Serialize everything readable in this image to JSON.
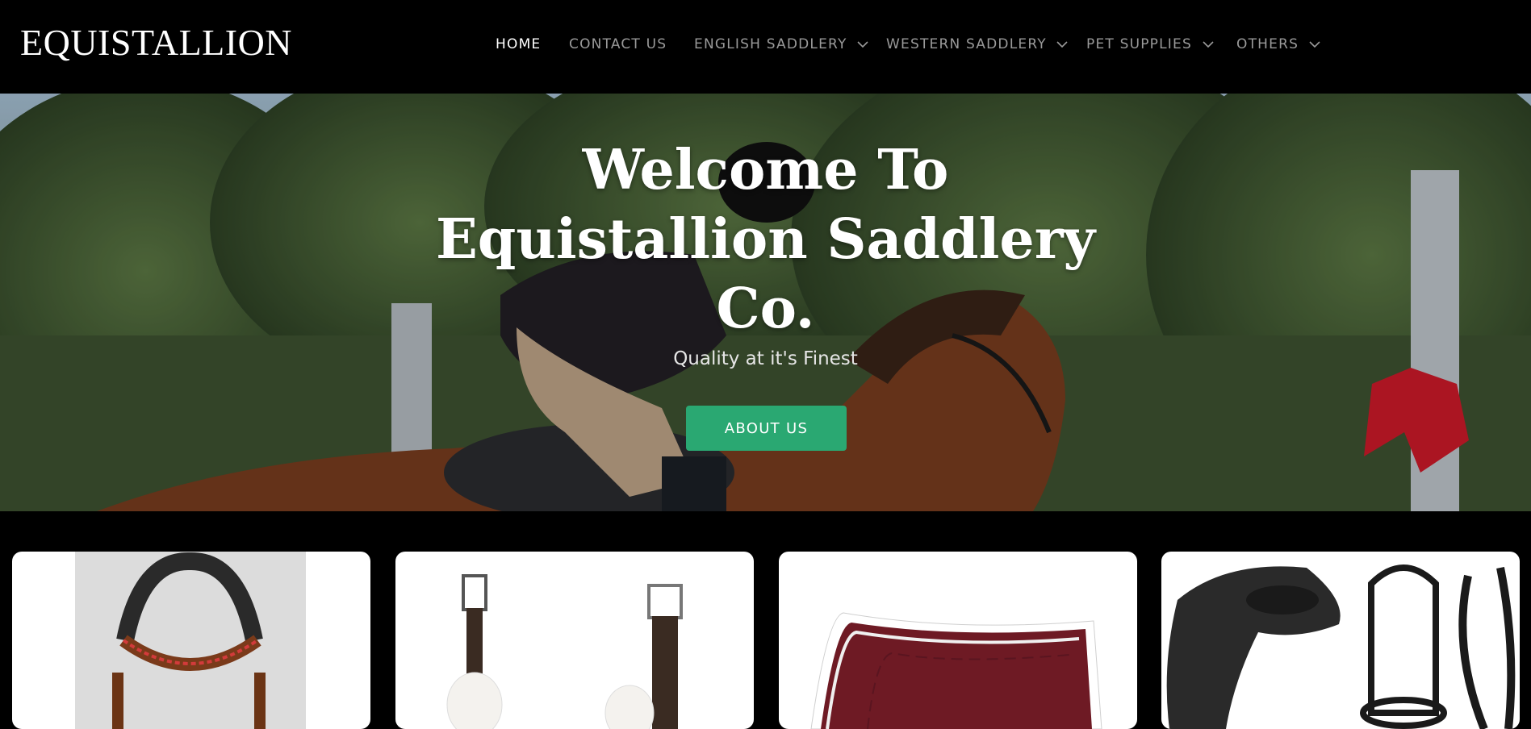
{
  "header": {
    "logo": "EQUISTALLION",
    "nav": [
      {
        "label": "HOME",
        "active": true,
        "dropdown": false
      },
      {
        "label": "CONTACT US",
        "active": false,
        "dropdown": false
      },
      {
        "label": "ENGLISH SADDLERY",
        "active": false,
        "dropdown": true
      },
      {
        "label": "WESTERN SADDLERY",
        "active": false,
        "dropdown": true
      },
      {
        "label": "PET SUPPLIES",
        "active": false,
        "dropdown": true
      },
      {
        "label": "OTHERS",
        "active": false,
        "dropdown": true
      }
    ]
  },
  "hero": {
    "title_lines": [
      "Welcome To",
      "Equistallion Saddlery",
      "Co."
    ],
    "subtitle": "Quality at it's Finest",
    "button_label": "ABOUT US",
    "button_color": "#2aa872"
  },
  "products": [
    {
      "image": "bridle-browband"
    },
    {
      "image": "girth-straps"
    },
    {
      "image": "saddle-pad"
    },
    {
      "image": "saddle-and-bridle-set"
    }
  ],
  "colors": {
    "background": "#000000",
    "nav_active": "#ffffff",
    "nav_inactive": "#9a9a9a"
  }
}
